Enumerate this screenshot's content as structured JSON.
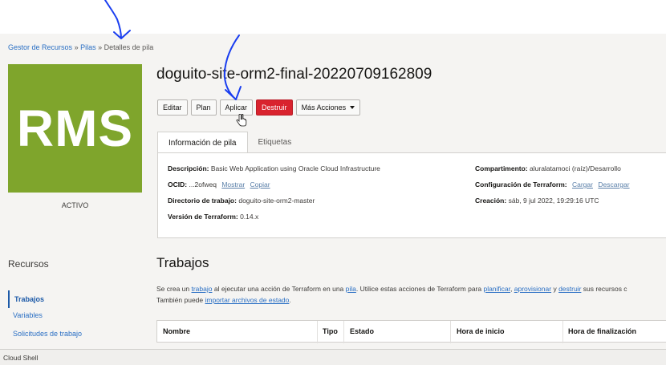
{
  "breadcrumb": {
    "items": [
      "Gestor de Recursos",
      "Pilas",
      "Detalles de pila"
    ],
    "separator": "»"
  },
  "logo": {
    "text": "RMS",
    "color": "#7fa52c"
  },
  "stack": {
    "status": "ACTIVO",
    "name": "doguito-site-orm2-final-20220709162809"
  },
  "toolbar": {
    "edit_label": "Editar",
    "plan_label": "Plan",
    "apply_label": "Aplicar",
    "destroy_label": "Destruir",
    "more_label": "Más Acciones",
    "destroy_color": "#d9232e"
  },
  "tabs": [
    {
      "label": "Información de pila",
      "active": true
    },
    {
      "label": "Etiquetas",
      "active": false
    }
  ],
  "info": {
    "description_label": "Descripción:",
    "description_value": "Basic Web Application using Oracle Cloud Infrastructure",
    "ocid_label": "OCID:",
    "ocid_value": "...2ofweq",
    "ocid_show": "Mostrar",
    "ocid_copy": "Copiar",
    "workdir_label": "Directorio de trabajo:",
    "workdir_value": "doguito-site-orm2-master",
    "tfversion_label": "Versión de Terraform:",
    "tfversion_value": "0.14.x",
    "compartment_label": "Compartimento:",
    "compartment_value": "aluralatamoci (raíz)/Desarrollo",
    "tfconfig_label": "Configuración de Terraform:",
    "tfconfig_upload": "Cargar",
    "tfconfig_download": "Descargar",
    "created_label": "Creación:",
    "created_value": "sáb, 9 jul 2022, 19:29:16 UTC"
  },
  "sidebar": {
    "title": "Recursos",
    "items": [
      {
        "label": "Trabajos",
        "active": true
      },
      {
        "label": "Variables",
        "active": false
      },
      {
        "label": "Solicitudes de trabajo",
        "active": false
      }
    ]
  },
  "jobs": {
    "title": "Trabajos",
    "desc_1": "Se crea un ",
    "desc_link_trabajo": "trabajo",
    "desc_2": " al ejecutar una acción de Terraform en una ",
    "desc_link_pila": "pila",
    "desc_3": ". Utilice estas acciones de Terraform para ",
    "desc_link_planificar": "planificar",
    "desc_4": ", ",
    "desc_link_aprovisionar": "aprovisionar",
    "desc_5": " y ",
    "desc_link_destruir": "destruir",
    "desc_6": " sus recursos c",
    "desc_line2_1": "También puede ",
    "desc_link_importar": "importar archivos de estado",
    "desc_line2_2": ".",
    "columns": [
      "Nombre",
      "Tipo",
      "Estado",
      "Hora de inicio",
      "Hora de finalización"
    ]
  },
  "footer": {
    "cloud_shell_label": "Cloud Shell"
  },
  "annotation_color": "#1a3ef0"
}
